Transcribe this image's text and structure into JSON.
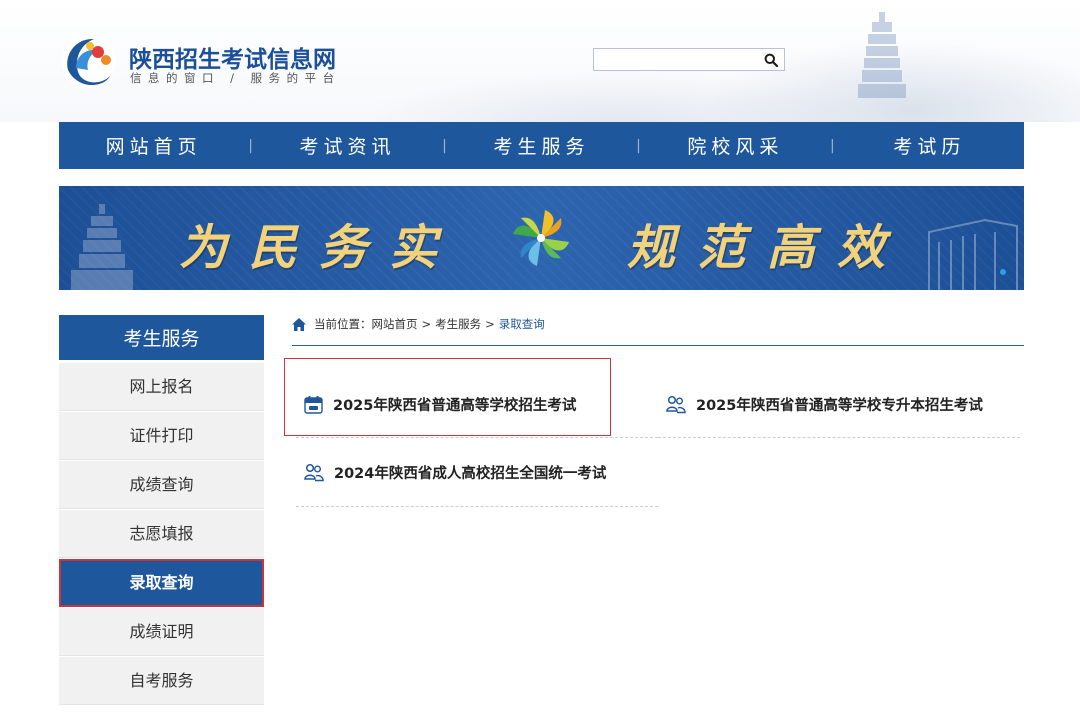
{
  "site": {
    "title": "陕西招生考试信息网",
    "subtitle": "信息的窗口 / 服务的平台"
  },
  "search": {
    "value": "",
    "placeholder": ""
  },
  "nav": {
    "items": [
      {
        "label": "网站首页"
      },
      {
        "label": "考试资讯"
      },
      {
        "label": "考生服务"
      },
      {
        "label": "院校风采"
      },
      {
        "label": "考试历"
      }
    ],
    "separator": "|"
  },
  "banner": {
    "slogan_left": "为民务实",
    "slogan_right": "规范高效"
  },
  "sidebar": {
    "heading": "考生服务",
    "items": [
      {
        "label": "网上报名",
        "active": false
      },
      {
        "label": "证件打印",
        "active": false
      },
      {
        "label": "成绩查询",
        "active": false
      },
      {
        "label": "志愿填报",
        "active": false
      },
      {
        "label": "录取查询",
        "active": true
      },
      {
        "label": "成绩证明",
        "active": false
      },
      {
        "label": "自考服务",
        "active": false
      }
    ]
  },
  "breadcrumb": {
    "prefix": "当前位置：",
    "home": "网站首页",
    "sep": ">",
    "section": "考生服务",
    "current": "录取查询"
  },
  "exams": [
    {
      "label": "2025年陕西省普通高等学校招生考试",
      "icon": "calendar-icon",
      "highlighted": true
    },
    {
      "label": "2025年陕西省普通高等学校专升本招生考试",
      "icon": "users-icon",
      "highlighted": false
    },
    {
      "label": "2024年陕西省成人高校招生全国统一考试",
      "icon": "users-icon",
      "highlighted": false
    }
  ],
  "colors": {
    "brand_blue": "#1f579d",
    "slogan_gold": "#f3d27a",
    "highlight_red": "#d2333a"
  }
}
